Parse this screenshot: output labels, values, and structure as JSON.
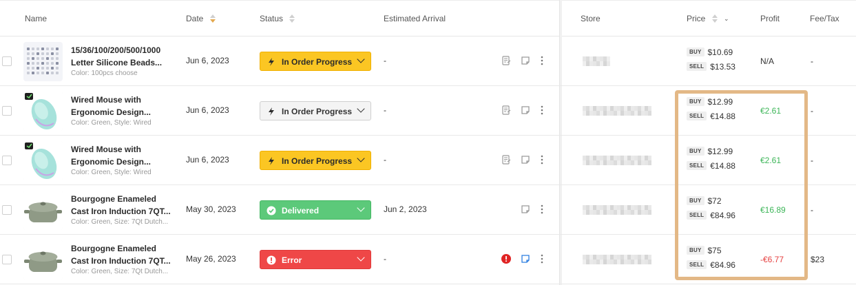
{
  "columns": {
    "name": "Name",
    "date": "Date",
    "status": "Status",
    "estimated_arrival": "Estimated Arrival",
    "store": "Store",
    "price": "Price",
    "profit": "Profit",
    "fee_tax": "Fee/Tax"
  },
  "colors": {
    "yellow_status": "#fbc623",
    "green_status": "#5cc97a",
    "red_status": "#ef4747",
    "profit_positive": "#3bb557",
    "profit_negative": "#e53e3e",
    "highlight_border": "#e3b886"
  },
  "rows": [
    {
      "name_line1": "15/36/100/200/500/1000",
      "name_line2": "Letter Silicone Beads...",
      "variant": "Color: 100pcs choose",
      "date": "Jun 6, 2023",
      "status": "In Order Progress",
      "status_style": "yellow",
      "arrival": "-",
      "buy_label": "BUY",
      "buy": "$10.69",
      "sell_label": "SELL",
      "sell": "$13.53",
      "profit": "N/A",
      "fee": "-"
    },
    {
      "name_line1": "Wired Mouse with",
      "name_line2": "Ergonomic Design...",
      "variant": "Color: Green, Style: Wired",
      "date": "Jun 6, 2023",
      "status": "In Order Progress",
      "status_style": "gray",
      "arrival": "-",
      "buy_label": "BUY",
      "buy": "$12.99",
      "sell_label": "SELL",
      "sell": "€14.88",
      "profit": "€2.61",
      "fee": "-"
    },
    {
      "name_line1": "Wired Mouse with",
      "name_line2": "Ergonomic Design...",
      "variant": "Color: Green, Style: Wired",
      "date": "Jun 6, 2023",
      "status": "In Order Progress",
      "status_style": "yellow",
      "arrival": "-",
      "buy_label": "BUY",
      "buy": "$12.99",
      "sell_label": "SELL",
      "sell": "€14.88",
      "profit": "€2.61",
      "fee": "-"
    },
    {
      "name_line1": "Bourgogne Enameled",
      "name_line2": "Cast Iron Induction 7QT...",
      "variant": "Color: Green, Size: 7Qt Dutch...",
      "date": "May 30, 2023",
      "status": "Delivered",
      "status_style": "green",
      "arrival": "Jun 2, 2023",
      "buy_label": "BUY",
      "buy": "$72",
      "sell_label": "SELL",
      "sell": "€84.96",
      "profit": "€16.89",
      "fee": "-"
    },
    {
      "name_line1": "Bourgogne Enameled",
      "name_line2": "Cast Iron Induction 7QT...",
      "variant": "Color: Green, Size: 7Qt Dutch...",
      "date": "May 26, 2023",
      "status": "Error",
      "status_style": "red",
      "arrival": "-",
      "buy_label": "BUY",
      "buy": "$75",
      "sell_label": "SELL",
      "sell": "€84.96",
      "profit": "-€6.77",
      "fee": "$23"
    }
  ]
}
